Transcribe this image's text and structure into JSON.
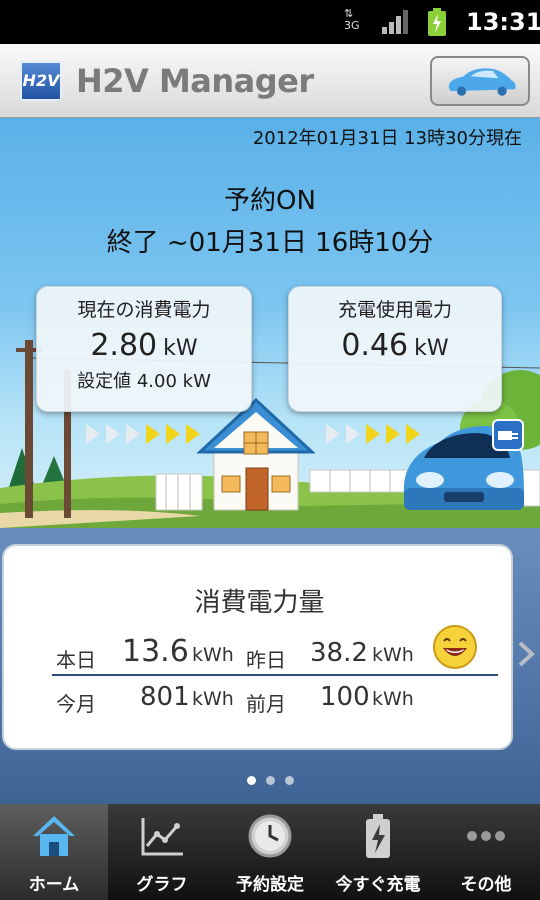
{
  "status_bar": {
    "network": "3G",
    "time": "13:31"
  },
  "app": {
    "title": "H2V Manager",
    "logo_text": "H2V"
  },
  "hero": {
    "timestamp": "2012年01月31日 13時30分現在",
    "reservation_status": "予約ON",
    "reservation_end": "終了 ~01月31日 16時10分",
    "current_power": {
      "label": "現在の消費電力",
      "value": "2.80",
      "unit": "kW",
      "setting": "設定値 4.00 kW"
    },
    "charging_power": {
      "label": "充電使用電力",
      "value": "0.46",
      "unit": "kW"
    }
  },
  "summary": {
    "title": "消費電力量",
    "today_label": "本日",
    "today_value": "13.6",
    "yesterday_label": "昨日",
    "yesterday_value": "38.2",
    "this_month_label": "今月",
    "this_month_value": "801",
    "last_month_label": "前月",
    "last_month_value": "100",
    "unit": "kWh",
    "page_count": 3,
    "active_page": 1
  },
  "nav": {
    "items": [
      {
        "label": "ホーム",
        "icon": "house-icon",
        "active": true
      },
      {
        "label": "グラフ",
        "icon": "chart-icon",
        "active": false
      },
      {
        "label": "予約設定",
        "icon": "clock-icon",
        "active": false
      },
      {
        "label": "今すぐ充電",
        "icon": "battery-charge-icon",
        "active": false
      },
      {
        "label": "その他",
        "icon": "more-icon",
        "active": false
      }
    ]
  },
  "colors": {
    "accent": "#2c4e7e",
    "sky": "#6cbcee",
    "arrow_yellow": "#f1d51c"
  }
}
